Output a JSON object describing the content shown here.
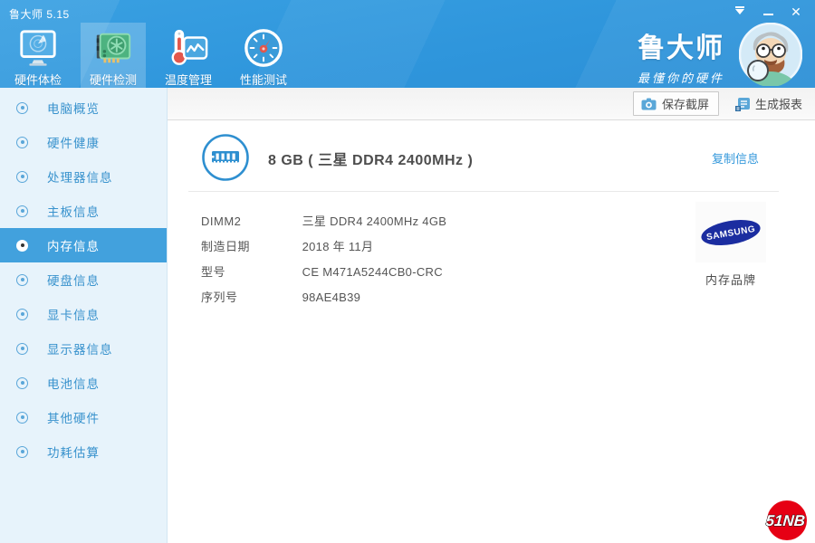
{
  "window": {
    "title": "鲁大师 5.15",
    "controls": {
      "close_glyph": "✕"
    }
  },
  "nav": {
    "tabs": [
      {
        "label": "硬件体检"
      },
      {
        "label": "硬件检测"
      },
      {
        "label": "温度管理"
      },
      {
        "label": "性能测试"
      }
    ],
    "active_tab": "硬件检测"
  },
  "brand": {
    "name": "鲁大师",
    "tagline": "最懂你的硬件"
  },
  "toolbar": {
    "screenshot_label": "保存截屏",
    "report_label": "生成报表"
  },
  "sidebar": {
    "items": [
      {
        "label": "电脑概览"
      },
      {
        "label": "硬件健康"
      },
      {
        "label": "处理器信息"
      },
      {
        "label": "主板信息"
      },
      {
        "label": "内存信息"
      },
      {
        "label": "硬盘信息"
      },
      {
        "label": "显卡信息"
      },
      {
        "label": "显示器信息"
      },
      {
        "label": "电池信息"
      },
      {
        "label": "其他硬件"
      },
      {
        "label": "功耗估算"
      }
    ],
    "selected": "内存信息"
  },
  "memory": {
    "summary": "8 GB ( 三星 DDR4 2400MHz )",
    "copy_label": "复制信息",
    "details": [
      {
        "label": "DIMM2",
        "value": "三星 DDR4 2400MHz 4GB"
      },
      {
        "label": "制造日期",
        "value": "2018 年 11月"
      },
      {
        "label": "型号",
        "value": "CE M471A5244CB0-CRC"
      },
      {
        "label": "序列号",
        "value": "98AE4B39"
      }
    ],
    "brand_logo_text": "SAMSUNG",
    "brand_caption": "内存品牌"
  },
  "watermark": {
    "text": "51NB"
  },
  "colors": {
    "header_blue": "#2f96dc",
    "accent_blue": "#3498db",
    "sidebar_selected": "#42a1dd",
    "samsung_blue": "#1b2da0",
    "watermark_red": "#e60014"
  }
}
